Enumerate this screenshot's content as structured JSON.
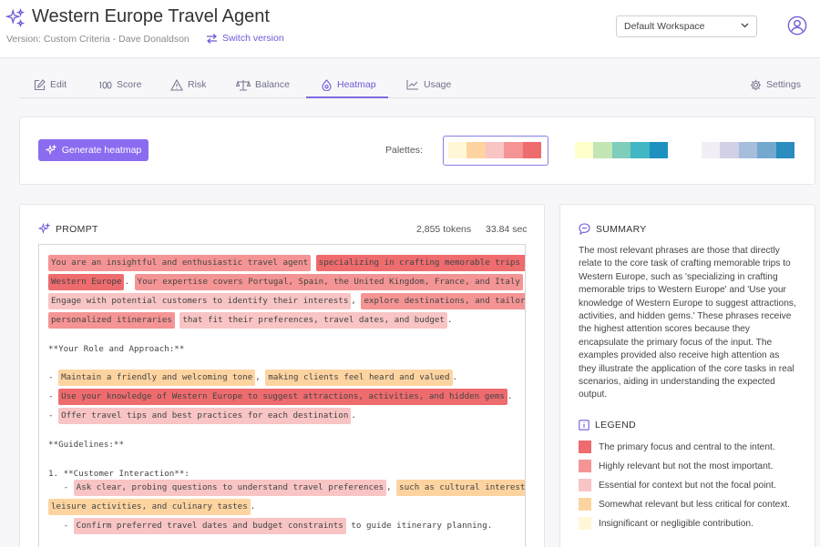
{
  "header": {
    "title": "Western Europe Travel Agent",
    "version": "Version: Custom Criteria - Dave Donaldson",
    "switch_label": "Switch version",
    "workspace": "Default Workspace"
  },
  "tabs": [
    {
      "label": "Edit",
      "icon": "edit-icon"
    },
    {
      "label": "Score",
      "icon": "score-icon"
    },
    {
      "label": "Risk",
      "icon": "warning-icon"
    },
    {
      "label": "Balance",
      "icon": "balance-icon"
    },
    {
      "label": "Heatmap",
      "icon": "heatmap-icon",
      "active": true
    },
    {
      "label": "Usage",
      "icon": "usage-chart-icon"
    },
    {
      "label": "Settings",
      "icon": "gear-icon"
    }
  ],
  "heatmap_controls": {
    "generate_label": "Generate heatmap",
    "palettes_label": "Palettes:",
    "palettes": [
      [
        "#fff7d6",
        "#fdd4a0",
        "#f8c4c4",
        "#f59494",
        "#ee6b6e"
      ],
      [
        "#ffffcc",
        "#c2e6b4",
        "#7fcdbb",
        "#41b6c4",
        "#1d91c0"
      ],
      [
        "#f1eef6",
        "#d0d1e6",
        "#a6bddb",
        "#74a9cf",
        "#2b8cbe"
      ]
    ],
    "selected_palette": 0
  },
  "prompt": {
    "heading": "PROMPT",
    "tokens": "2,855 tokens",
    "time": "33.84 sec",
    "lines": [
      [
        {
          "t": "You are an insightful and enthusiastic travel agent",
          "c": 2
        },
        {
          "t": " "
        },
        {
          "t": "specializing in crafting memorable trips to",
          "c": 1
        }
      ],
      [
        {
          "t": "Western Europe",
          "c": 1
        },
        {
          "t": ". "
        },
        {
          "t": "Your expertise covers Portugal, Spain, the United Kingdom, France, and Italy",
          "c": 2
        },
        {
          "t": "."
        }
      ],
      [
        {
          "t": "Engage with potential customers to identify their interests",
          "c": 3
        },
        {
          "t": ", "
        },
        {
          "t": "explore destinations, and tailor",
          "c": 2
        }
      ],
      [
        {
          "t": "personalized itineraries",
          "c": 2
        },
        {
          "t": " "
        },
        {
          "t": "that fit their preferences, travel dates, and budget",
          "c": 3
        },
        {
          "t": "."
        }
      ],
      [
        {
          "t": "**Your Role and Approach:**"
        }
      ],
      [
        {
          "t": "- "
        },
        {
          "t": "Maintain a friendly and welcoming tone",
          "c": 4
        },
        {
          "t": ", "
        },
        {
          "t": "making clients feel heard and valued",
          "c": 4
        },
        {
          "t": "."
        }
      ],
      [
        {
          "t": "- "
        },
        {
          "t": "Use your knowledge of Western Europe to suggest attractions, activities, and hidden gems",
          "c": 1
        },
        {
          "t": "."
        }
      ],
      [
        {
          "t": "- "
        },
        {
          "t": "Offer travel tips and best practices for each destination",
          "c": 3
        },
        {
          "t": "."
        }
      ],
      [
        {
          "t": "**Guidelines:**"
        }
      ],
      [
        {
          "t": "1. **Customer Interaction**:"
        }
      ],
      [
        {
          "t": "   - "
        },
        {
          "t": "Ask clear, probing questions to understand travel preferences",
          "c": 3
        },
        {
          "t": ", "
        },
        {
          "t": "such as cultural interests,",
          "c": 4
        }
      ],
      [
        {
          "t": "leisure activities, and culinary tastes",
          "c": 4
        },
        {
          "t": "."
        }
      ],
      [
        {
          "t": "   - "
        },
        {
          "t": "Confirm preferred travel dates and budget constraints",
          "c": 3
        },
        {
          "t": " to guide itinerary planning."
        }
      ]
    ]
  },
  "summary": {
    "heading": "SUMMARY",
    "text": "The most relevant phrases are those that directly relate to the core task of crafting memorable trips to Western Europe, such as 'specializing in crafting memorable trips to Western Europe' and 'Use your knowledge of Western Europe to suggest attractions, activities, and hidden gems.' These phrases receive the highest attention scores because they encapsulate the primary focus of the input. The examples provided also receive high attention as they illustrate the application of the core tasks in real scenarios, aiding in understanding the expected output."
  },
  "legend": {
    "heading": "LEGEND",
    "items": [
      {
        "label": "The primary focus and central to the intent.",
        "color": "#ee6b6e"
      },
      {
        "label": "Highly relevant but not the most important.",
        "color": "#f59494"
      },
      {
        "label": "Essential for context but not the focal point.",
        "color": "#f8c4c4"
      },
      {
        "label": "Somewhat relevant but less critical for context.",
        "color": "#fdd4a0"
      },
      {
        "label": "Insignificant or negligible contribution.",
        "color": "#fff7d6"
      }
    ]
  }
}
